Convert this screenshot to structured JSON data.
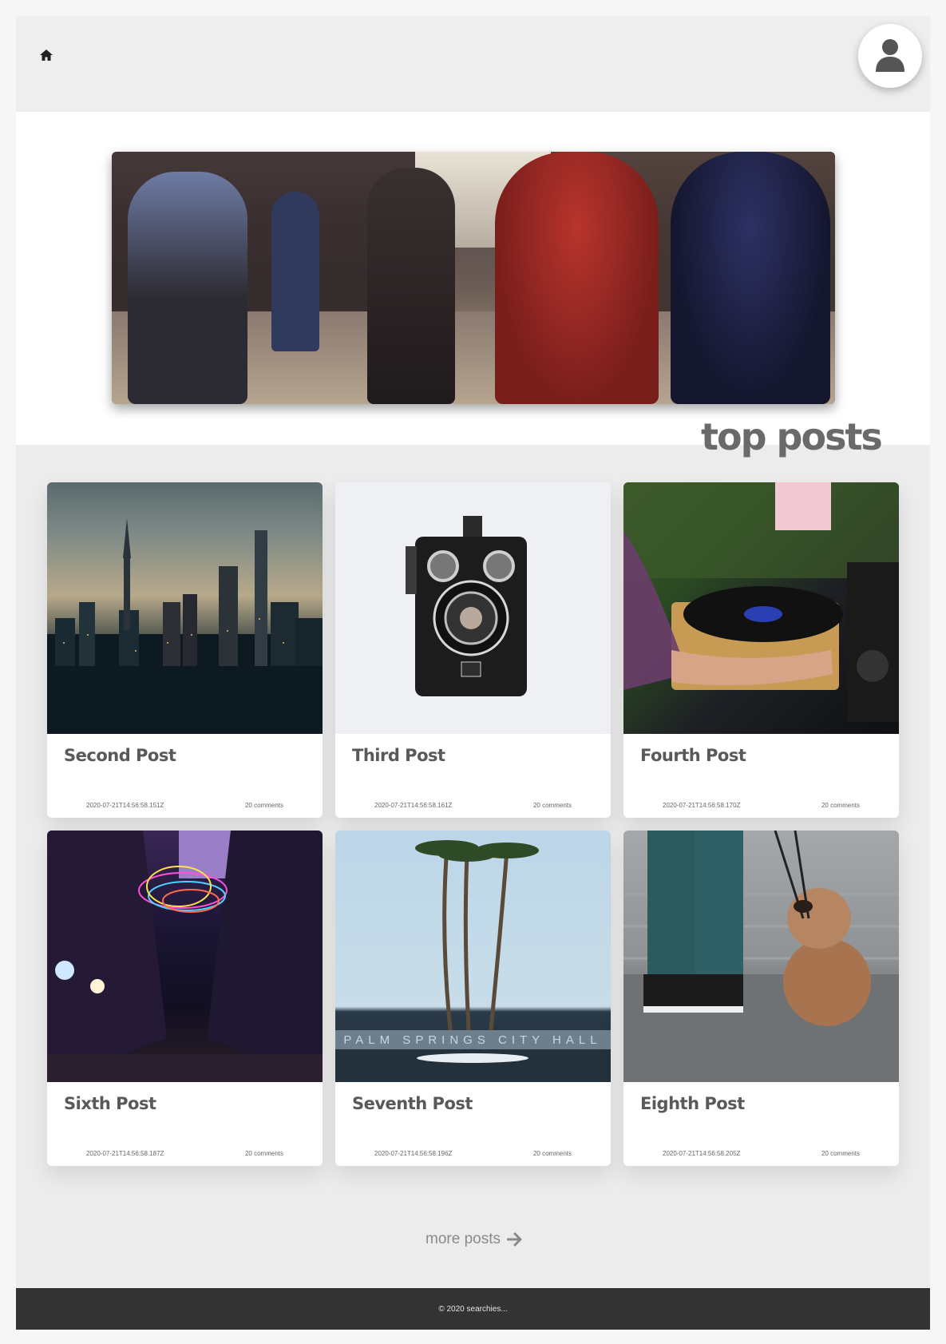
{
  "nav": {
    "home_icon": "home-icon",
    "avatar_icon": "user-icon"
  },
  "hero": {
    "image": "street-crowd-photo"
  },
  "section": {
    "title": "top posts"
  },
  "posts": [
    {
      "title": "Second Post",
      "date": "2020-07-21T14:56:58.151Z",
      "comments": "20 comments",
      "image": "city-skyline-photo"
    },
    {
      "title": "Third Post",
      "date": "2020-07-21T14:56:58.161Z",
      "comments": "20 comments",
      "image": "vintage-camera-photo"
    },
    {
      "title": "Fourth Post",
      "date": "2020-07-21T14:56:58.170Z",
      "comments": "20 comments",
      "image": "record-player-photo"
    },
    {
      "title": "Sixth Post",
      "date": "2020-07-21T14:56:58.187Z",
      "comments": "20 comments",
      "image": "neon-street-photo"
    },
    {
      "title": "Seventh Post",
      "date": "2020-07-21T14:56:58.196Z",
      "comments": "20 comments",
      "image": "palm-trees-photo"
    },
    {
      "title": "Eighth Post",
      "date": "2020-07-21T14:56:58.205Z",
      "comments": "20 comments",
      "image": "dog-sneakers-photo"
    }
  ],
  "palm_sign": "PALM SPRINGS CITY HALL",
  "more": {
    "label": "more posts",
    "icon": "arrow-right-icon"
  },
  "footer": {
    "text": "© 2020 searchies..."
  },
  "colors": {
    "page_bg": "#ececec",
    "footer_bg": "#333333",
    "title": "#6a6a6a"
  }
}
